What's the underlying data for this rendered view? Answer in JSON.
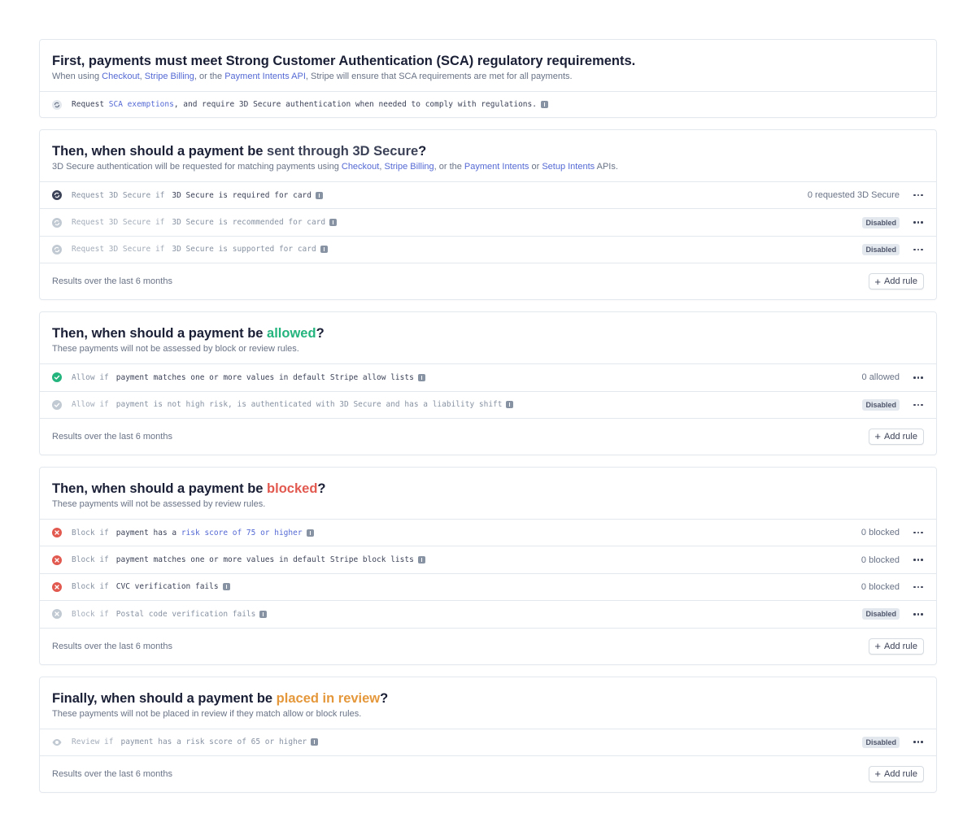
{
  "sca": {
    "title": "First, payments must meet Strong Customer Authentication (SCA) regulatory requirements.",
    "sub_pre": "When using ",
    "link_checkout": "Checkout",
    "sep1": ", ",
    "link_billing": "Stripe Billing",
    "sep2": ", or the ",
    "link_pi_api": "Payment Intents API",
    "sub_post": ", Stripe will ensure that SCA requirements are met for all payments.",
    "rule_pre": "Request ",
    "rule_link": "SCA exemptions",
    "rule_post": ", and require 3D Secure authentication when needed to comply with regulations."
  },
  "three_ds": {
    "title_pre": "Then, when should a payment be ",
    "title_hl": "sent through 3D Secure",
    "title_post": "?",
    "sub_pre": "3D Secure authentication will be requested for matching payments using ",
    "link_checkout": "Checkout",
    "sep1": ", ",
    "link_billing": "Stripe Billing",
    "sep2": ", or the ",
    "link_pi": "Payment Intents",
    "sep3": " or ",
    "link_si": "Setup Intents",
    "sub_post": " APIs.",
    "rules": [
      {
        "kw": "Request 3D Secure if",
        "cond": "3D Secure is required for card",
        "count": "0 requested 3D Secure"
      },
      {
        "kw": "Request 3D Secure if",
        "cond": "3D Secure is recommended for card",
        "badge": "Disabled"
      },
      {
        "kw": "Request 3D Secure if",
        "cond": "3D Secure is supported for card",
        "badge": "Disabled"
      }
    ],
    "footer": "Results over the last 6 months",
    "add_label": "Add rule"
  },
  "allow": {
    "title_pre": "Then, when should a payment be ",
    "title_hl": "allowed",
    "title_post": "?",
    "sub": "These payments will not be assessed by block or review rules.",
    "rules": [
      {
        "kw": "Allow if",
        "cond": "payment matches one or more values in default Stripe allow lists",
        "count": "0 allowed"
      },
      {
        "kw": "Allow if",
        "cond": "payment is not high risk, is authenticated with 3D Secure and has a liability shift",
        "badge": "Disabled"
      }
    ],
    "footer": "Results over the last 6 months",
    "add_label": "Add rule"
  },
  "block": {
    "title_pre": "Then, when should a payment be ",
    "title_hl": "blocked",
    "title_post": "?",
    "sub": "These payments will not be assessed by review rules.",
    "rules": [
      {
        "kw": "Block if",
        "cond_pre": "payment has a ",
        "cond_link": "risk score of 75 or higher",
        "count": "0 blocked"
      },
      {
        "kw": "Block if",
        "cond": "payment matches one or more values in default Stripe block lists",
        "count": "0 blocked"
      },
      {
        "kw": "Block if",
        "cond": "CVC verification fails",
        "count": "0 blocked"
      },
      {
        "kw": "Block if",
        "cond": "Postal code verification fails",
        "badge": "Disabled"
      }
    ],
    "footer": "Results over the last 6 months",
    "add_label": "Add rule"
  },
  "review": {
    "title_pre": "Finally, when should a payment be ",
    "title_hl": "placed in review",
    "title_post": "?",
    "sub": "These payments will not be placed in review if they match allow or block rules.",
    "rules": [
      {
        "kw": "Review if",
        "cond": "payment has a risk score of 65 or higher",
        "badge": "Disabled"
      }
    ],
    "footer": "Results over the last 6 months",
    "add_label": "Add rule"
  },
  "colors": {
    "link": "#5469d4",
    "allow": "#24b47e",
    "block": "#e25950",
    "review": "#e5983b",
    "border": "#e3e8ee"
  },
  "icons": {
    "sca": "refresh-circle-icon",
    "three_ds_on": "refresh-circle-icon",
    "allow_on": "check-circle-icon",
    "block_on": "x-circle-icon",
    "review": "eye-icon",
    "more": "ellipsis-icon",
    "add": "plus-icon",
    "info": "info-icon"
  }
}
